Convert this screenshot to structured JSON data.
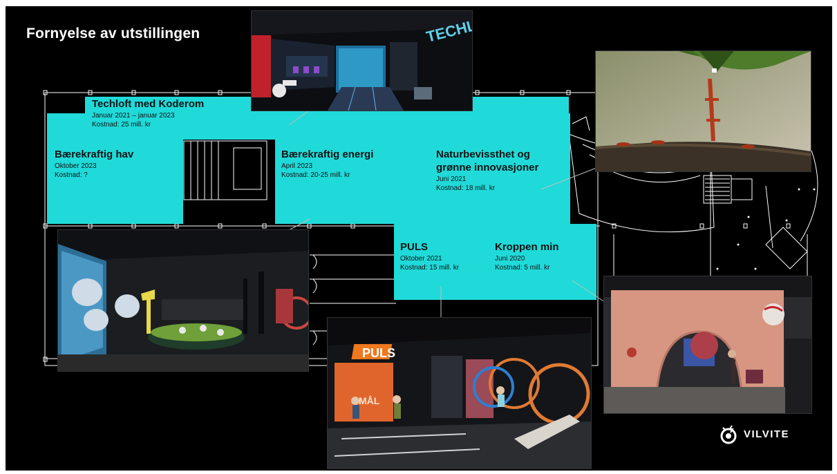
{
  "slide": {
    "title": "Fornyelse av utstillingen"
  },
  "zones": {
    "techloft": {
      "title": "Techloft med Koderom",
      "date": "Januar 2021 – januar 2023",
      "cost": "Kostnad: 25 mill. kr"
    },
    "hav": {
      "title": "Bærekraftig hav",
      "date": "Oktober 2023",
      "cost": "Kostnad: ?"
    },
    "energi": {
      "title": "Bærekraftig energi",
      "date": "April 2023",
      "cost": "Kostnad: 20-25 mill. kr"
    },
    "natur": {
      "title_line1": "Naturbevissthet og",
      "title_line2": "grønne innovasjoner",
      "date": "Juni 2021",
      "cost": "Kostnad: 18 mill. kr"
    },
    "puls": {
      "title": "PULS",
      "date": "Oktober 2021",
      "cost": "Kostnad: 15 mill. kr"
    },
    "kroppen": {
      "title": "Kroppen min",
      "date": "Juni 2020",
      "cost": "Kostnad: 5 mill. kr"
    }
  },
  "photos": {
    "techloft_sign": "TECHLO",
    "puls_sign": "PULS",
    "puls_goal": "MÅL"
  },
  "logo": {
    "text": "VILVITE"
  },
  "colors": {
    "zone": "#1fdad9",
    "background": "#000000",
    "title": "#ffffff"
  }
}
